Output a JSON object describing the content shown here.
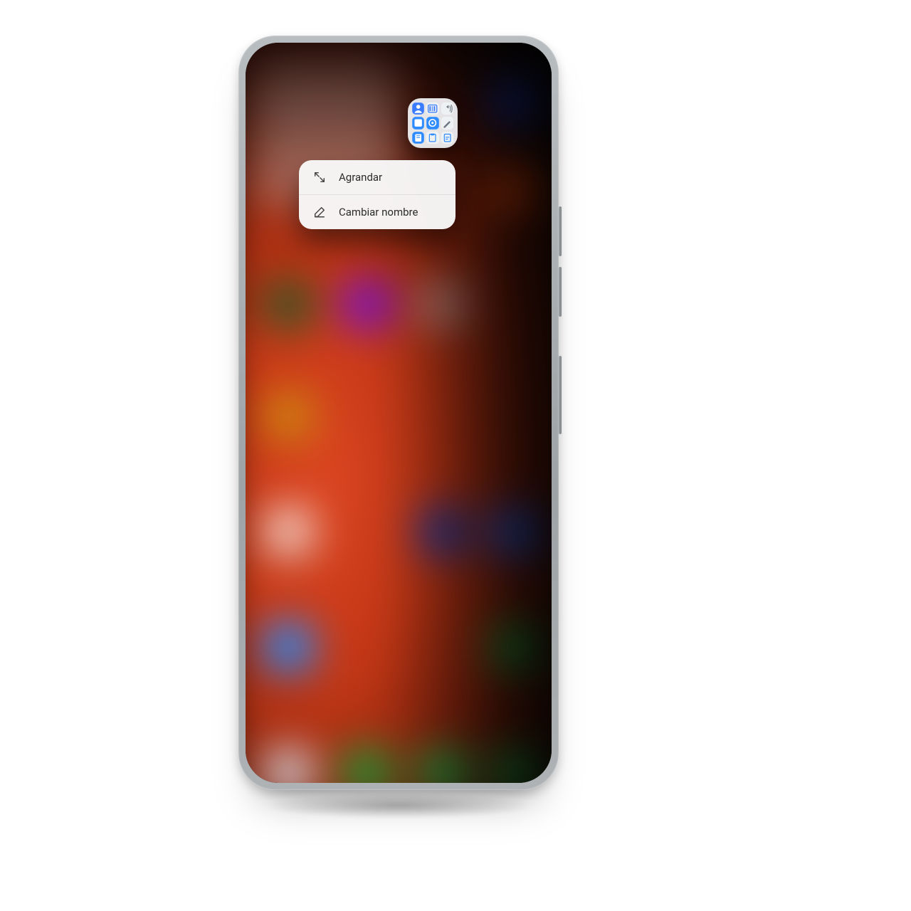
{
  "context_menu": {
    "items": [
      {
        "label": "Agrandar",
        "icon_name": "expand-icon"
      },
      {
        "label": "Cambiar nombre",
        "icon_name": "rename-icon"
      }
    ]
  },
  "folder": {
    "mini_icons": [
      "contacts-icon",
      "barcode-icon",
      "volume-icon",
      "app-icon",
      "gear-icon",
      "draw-icon",
      "notes-icon",
      "clipboard-icon",
      "file-icon"
    ]
  }
}
